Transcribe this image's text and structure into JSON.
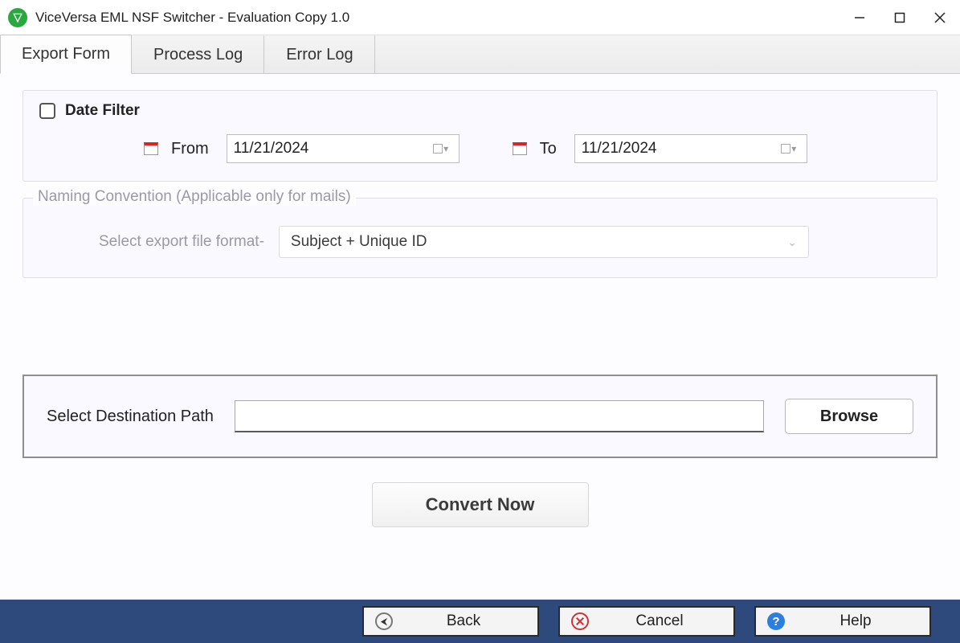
{
  "window": {
    "title": "ViceVersa EML NSF Switcher - Evaluation Copy 1.0"
  },
  "tabs": {
    "export_form": "Export Form",
    "process_log": "Process Log",
    "error_log": "Error Log"
  },
  "date_filter": {
    "label": "Date Filter",
    "from_label": "From",
    "from_value": "11/21/2024",
    "to_label": "To",
    "to_value": "11/21/2024"
  },
  "naming": {
    "legend": "Naming Convention (Applicable only for mails)",
    "format_label": "Select export file format-",
    "format_value": "Subject + Unique ID"
  },
  "destination": {
    "label": "Select Destination Path",
    "value": "",
    "browse": "Browse"
  },
  "actions": {
    "convert": "Convert Now"
  },
  "footer": {
    "back": "Back",
    "cancel": "Cancel",
    "help": "Help"
  }
}
